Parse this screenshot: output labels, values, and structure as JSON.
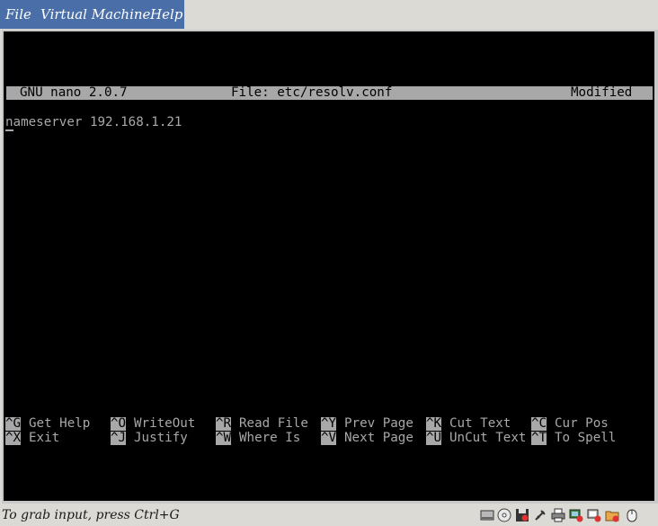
{
  "menu": {
    "items": [
      "File",
      "Virtual Machine",
      "Help"
    ]
  },
  "nano": {
    "app": "GNU nano 2.0.7",
    "file": "File: etc/resolv.conf",
    "status": "Modified",
    "content": "nameserver 192.168.1.21",
    "shortcuts_row1": [
      {
        "key": "^G",
        "label": "Get Help"
      },
      {
        "key": "^O",
        "label": "WriteOut"
      },
      {
        "key": "^R",
        "label": "Read File"
      },
      {
        "key": "^Y",
        "label": "Prev Page"
      },
      {
        "key": "^K",
        "label": "Cut Text"
      },
      {
        "key": "^C",
        "label": "Cur Pos"
      }
    ],
    "shortcuts_row2": [
      {
        "key": "^X",
        "label": "Exit"
      },
      {
        "key": "^J",
        "label": "Justify"
      },
      {
        "key": "^W",
        "label": "Where Is"
      },
      {
        "key": "^V",
        "label": "Next Page"
      },
      {
        "key": "^U",
        "label": "UnCut Text"
      },
      {
        "key": "^T",
        "label": "To Spell"
      }
    ]
  },
  "statusbar": {
    "text": "To grab input, press Ctrl+G",
    "icons": [
      "hard-disk-icon",
      "cd-icon",
      "floppy-icon",
      "usb-icon",
      "printer-icon",
      "network-icon",
      "network-2-icon",
      "shared-folder-icon",
      "mouse-grab-icon"
    ]
  },
  "colors": {
    "menu_highlight": "#4a6ea8",
    "terminal_bg": "#000000",
    "terminal_fg": "#a8a8a8"
  }
}
